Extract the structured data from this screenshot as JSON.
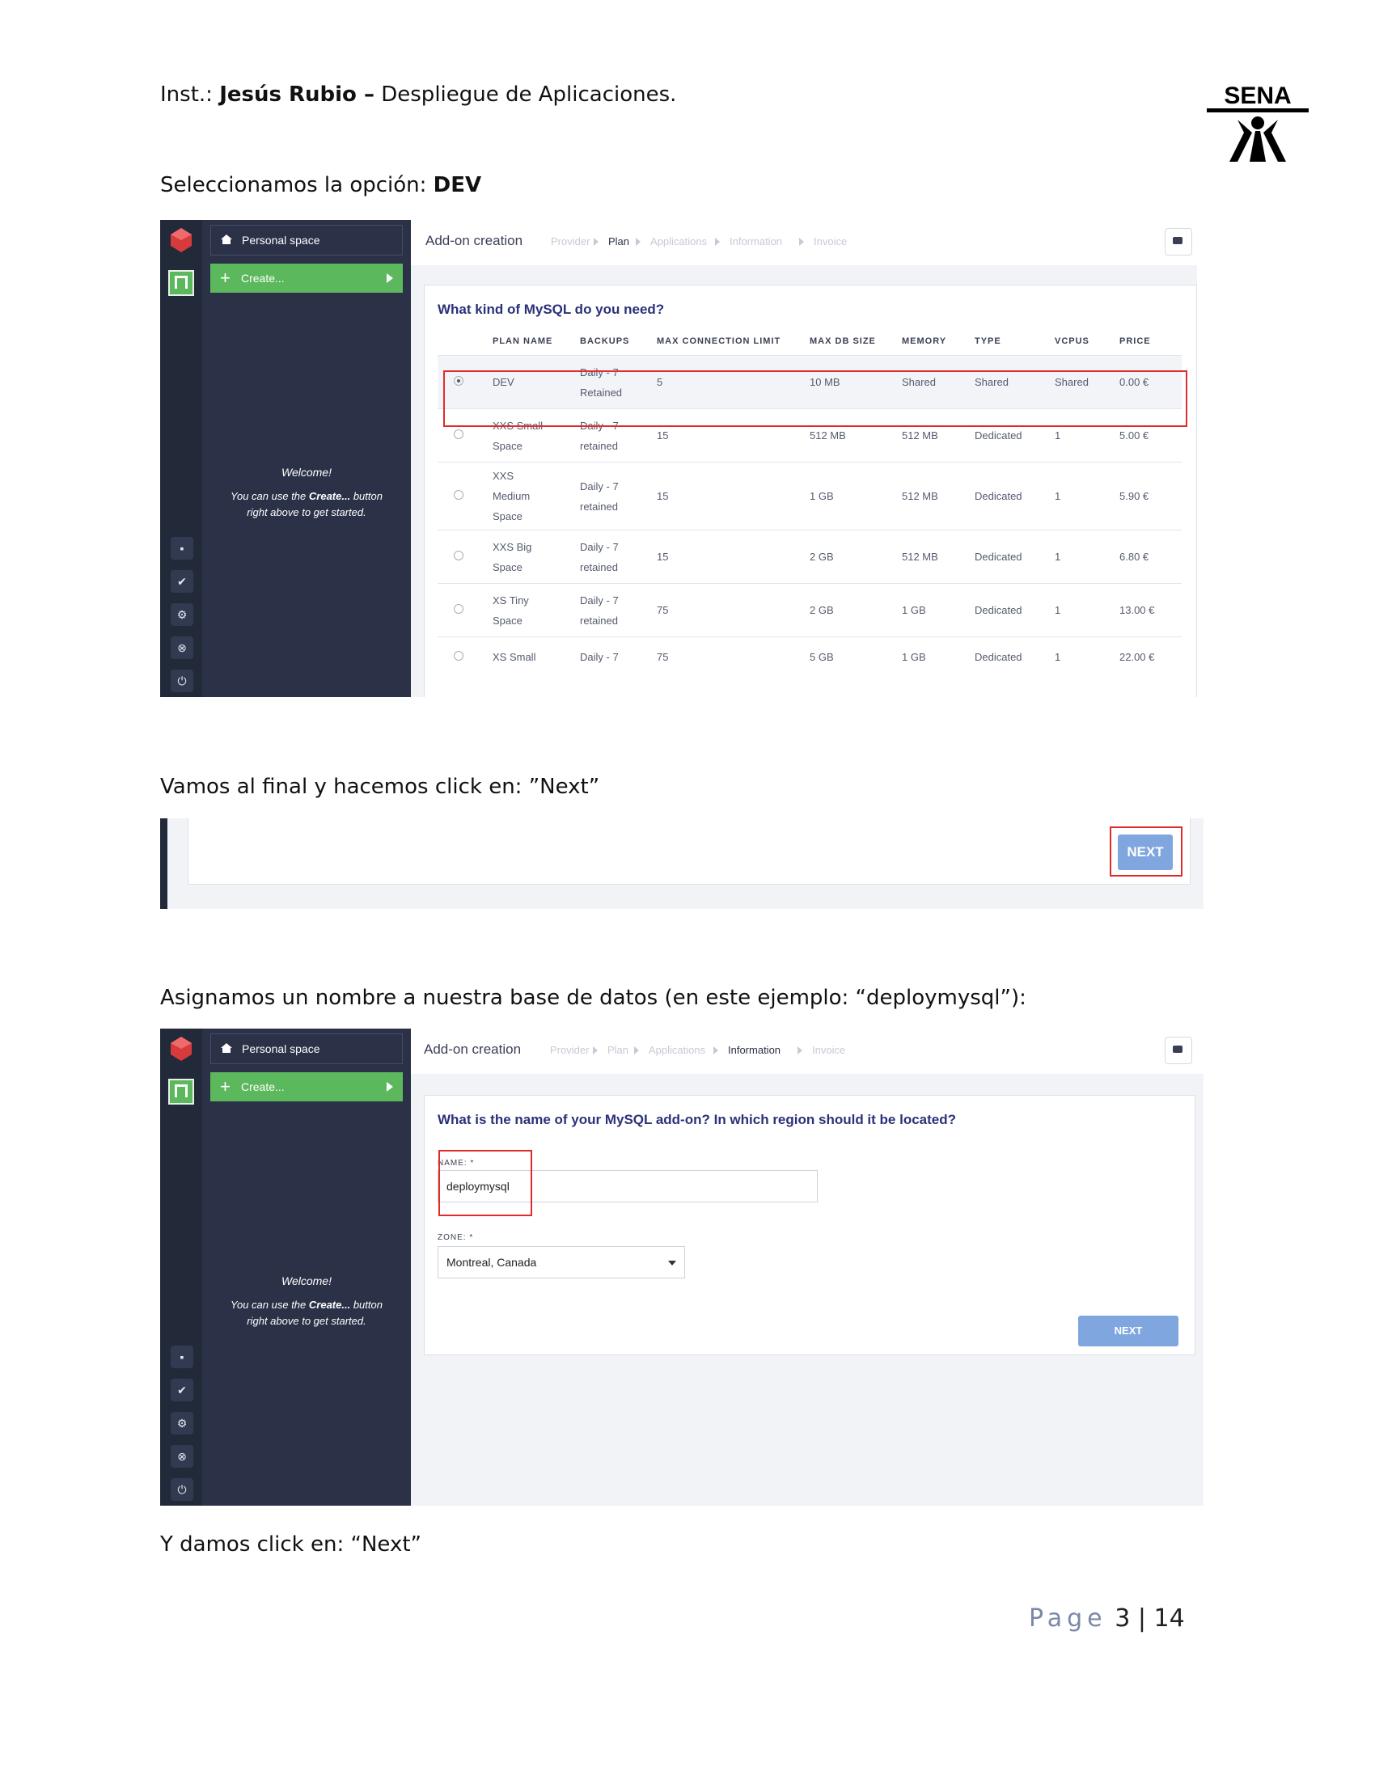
{
  "header": {
    "prefix": "Inst.: ",
    "author": "Jesús Rubio –",
    "subject": " Despliegue de Aplicaciones.",
    "logo_text": "SENA"
  },
  "step1": {
    "text": "Seleccionamos la opción: ",
    "emphasis": "DEV"
  },
  "step2": {
    "text": "Vamos al final y hacemos click en: ”Next”"
  },
  "step3": {
    "text": "Asignamos un nombre a nuestra base de datos (en este ejemplo: “deploymysql”):"
  },
  "step4": {
    "text": "Y damos click en: “Next”"
  },
  "sidebar": {
    "personal_space": "Personal space",
    "create_label": "Create...",
    "welcome_title": "Welcome!",
    "welcome_line1_pre": "You can use the ",
    "welcome_line1_bold": "Create...",
    "welcome_line1_post": " button",
    "welcome_line2": "right above to get started."
  },
  "breadcrumb": {
    "title": "Add-on creation",
    "steps": [
      "Provider",
      "Plan",
      "Applications",
      "Information",
      "Invoice"
    ]
  },
  "plan_screen": {
    "question": "What kind of MySQL do you need?",
    "columns": [
      "PLAN NAME",
      "BACKUPS",
      "MAX CONNECTION LIMIT",
      "MAX DB SIZE",
      "MEMORY",
      "TYPE",
      "VCPUS",
      "PRICE"
    ],
    "rows": [
      {
        "name": [
          "DEV"
        ],
        "backups": [
          "Daily - 7",
          "Retained"
        ],
        "conn": "5",
        "db": "10 MB",
        "memory": "Shared",
        "type": "Shared",
        "vcpus": "Shared",
        "price": "0.00 €",
        "selected": true
      },
      {
        "name": [
          "XXS Small",
          "Space"
        ],
        "backups": [
          "Daily - 7",
          "retained"
        ],
        "conn": "15",
        "db": "512 MB",
        "memory": "512 MB",
        "type": "Dedicated",
        "vcpus": "1",
        "price": "5.00 €",
        "selected": false
      },
      {
        "name": [
          "XXS",
          "Medium",
          "Space"
        ],
        "backups": [
          "Daily - 7",
          "retained"
        ],
        "conn": "15",
        "db": "1 GB",
        "memory": "512 MB",
        "type": "Dedicated",
        "vcpus": "1",
        "price": "5.90 €",
        "selected": false
      },
      {
        "name": [
          "XXS Big",
          "Space"
        ],
        "backups": [
          "Daily - 7",
          "retained"
        ],
        "conn": "15",
        "db": "2 GB",
        "memory": "512 MB",
        "type": "Dedicated",
        "vcpus": "1",
        "price": "6.80 €",
        "selected": false
      },
      {
        "name": [
          "XS Tiny",
          "Space"
        ],
        "backups": [
          "Daily - 7",
          "retained"
        ],
        "conn": "75",
        "db": "2 GB",
        "memory": "1 GB",
        "type": "Dedicated",
        "vcpus": "1",
        "price": "13.00 €",
        "selected": false
      },
      {
        "name": [
          "XS Small"
        ],
        "backups": [
          "Daily - 7"
        ],
        "conn": "75",
        "db": "5 GB",
        "memory": "1 GB",
        "type": "Dedicated",
        "vcpus": "1",
        "price": "22.00 €",
        "selected": false
      }
    ]
  },
  "next_screen": {
    "next_label": "NEXT"
  },
  "info_screen": {
    "question": "What is the name of your MySQL add-on? In which region should it be located?",
    "name_label": "NAME: *",
    "name_value": "deploymysql",
    "zone_label": "ZONE: *",
    "zone_value": "Montreal, Canada",
    "next_label": "NEXT"
  },
  "footer": {
    "page_word": "Page",
    "page": "3",
    "separator": "|",
    "total": "14"
  },
  "colors": {
    "sidebar": "#2b3147",
    "create": "#5cb85c",
    "highlight": "#e02b2b",
    "next": "#7fa6de",
    "question": "#2b3178"
  }
}
